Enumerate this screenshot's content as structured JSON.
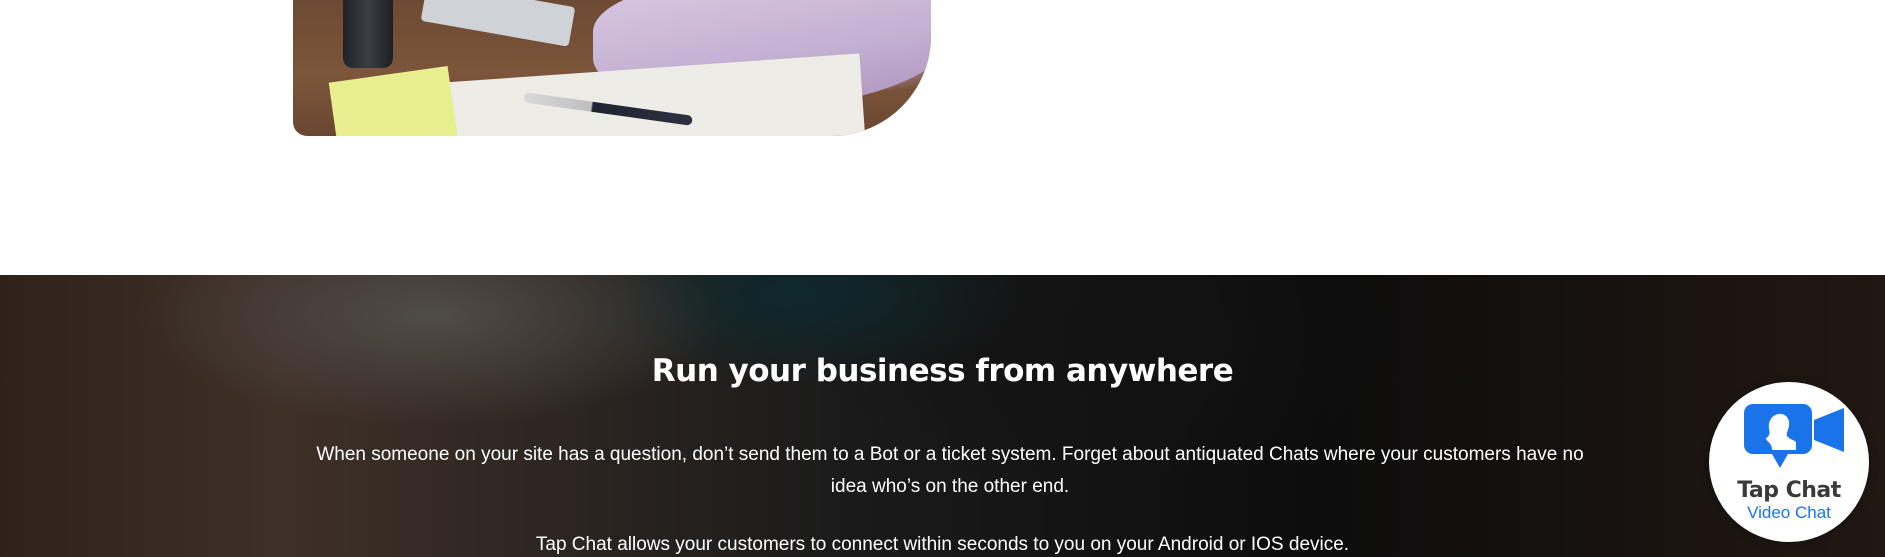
{
  "hero": {
    "title": "Run your business from anywhere",
    "paragraph1": "When someone on your site has a question, don’t send them to a Bot or a ticket system. Forget about antiquated Chats where your customers have no idea who’s on the other end.",
    "paragraph2": "Tap Chat allows your customers to connect within seconds to you on your Android or IOS device."
  },
  "chat_widget": {
    "brand": "Tap Chat",
    "subtitle": "Video Chat",
    "icon": "video-camera-person-icon",
    "accent_color": "#1a73e8"
  },
  "colors": {
    "hero_overlay": "#000000",
    "hero_text": "#ffffff",
    "page_background": "#ffffff"
  }
}
